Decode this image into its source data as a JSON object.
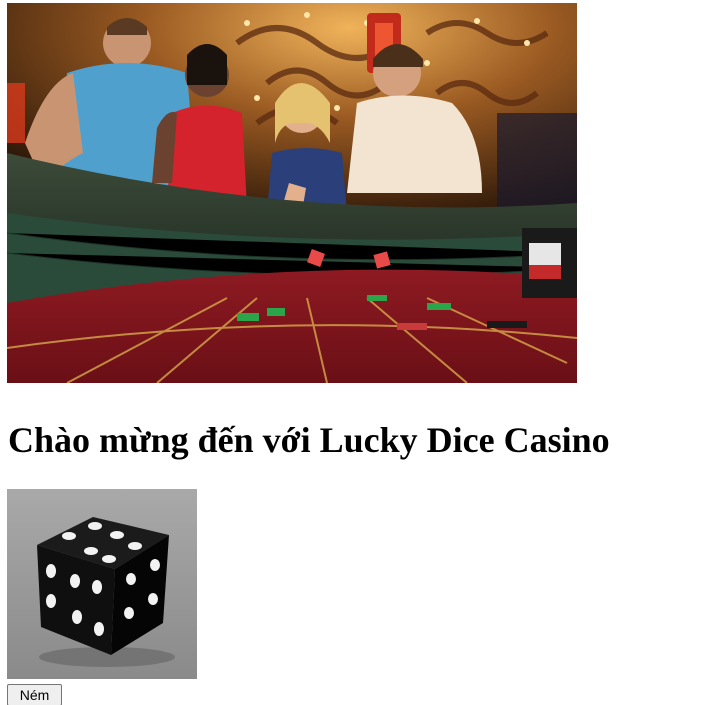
{
  "hero_image": {
    "icon": "casino-craps-table-photo"
  },
  "page": {
    "heading": "Chào mừng đến với Lucky Dice Casino"
  },
  "dice_image": {
    "icon": "black-die-icon"
  },
  "roll_button": {
    "label": "Ném"
  }
}
